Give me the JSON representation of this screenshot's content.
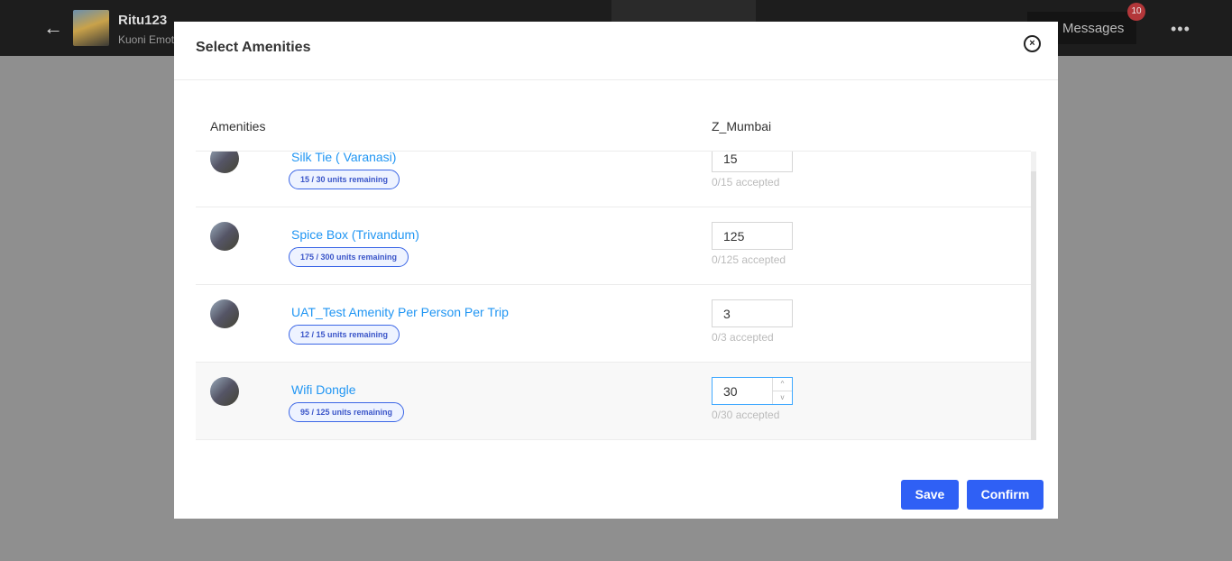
{
  "topbar": {
    "user": "Ritu123",
    "subtitle": "Kuoni Emoti",
    "messages_label": "Messages",
    "messages_count": "10"
  },
  "modal": {
    "title": "Select Amenities",
    "columns": {
      "amenities": "Amenities",
      "location": "Z_Mumbai"
    },
    "rows": [
      {
        "name": "Silk Tie ( Varanasi)",
        "remaining": "15 / 30 units remaining",
        "quantity": "15",
        "accepted": "0/15 accepted"
      },
      {
        "name": "Spice Box (Trivandum)",
        "remaining": "175 / 300 units remaining",
        "quantity": "125",
        "accepted": "0/125 accepted"
      },
      {
        "name": "UAT_Test Amenity Per Person Per Trip",
        "remaining": "12 / 15 units remaining",
        "quantity": "3",
        "accepted": "0/3 accepted"
      },
      {
        "name": "Wifi Dongle",
        "remaining": "95 / 125 units remaining",
        "quantity": "30",
        "accepted": "0/30 accepted"
      }
    ],
    "save_label": "Save",
    "confirm_label": "Confirm"
  },
  "colors": {
    "accent": "#2f60f5",
    "link": "#2196f3",
    "badge": "#b3373a"
  }
}
